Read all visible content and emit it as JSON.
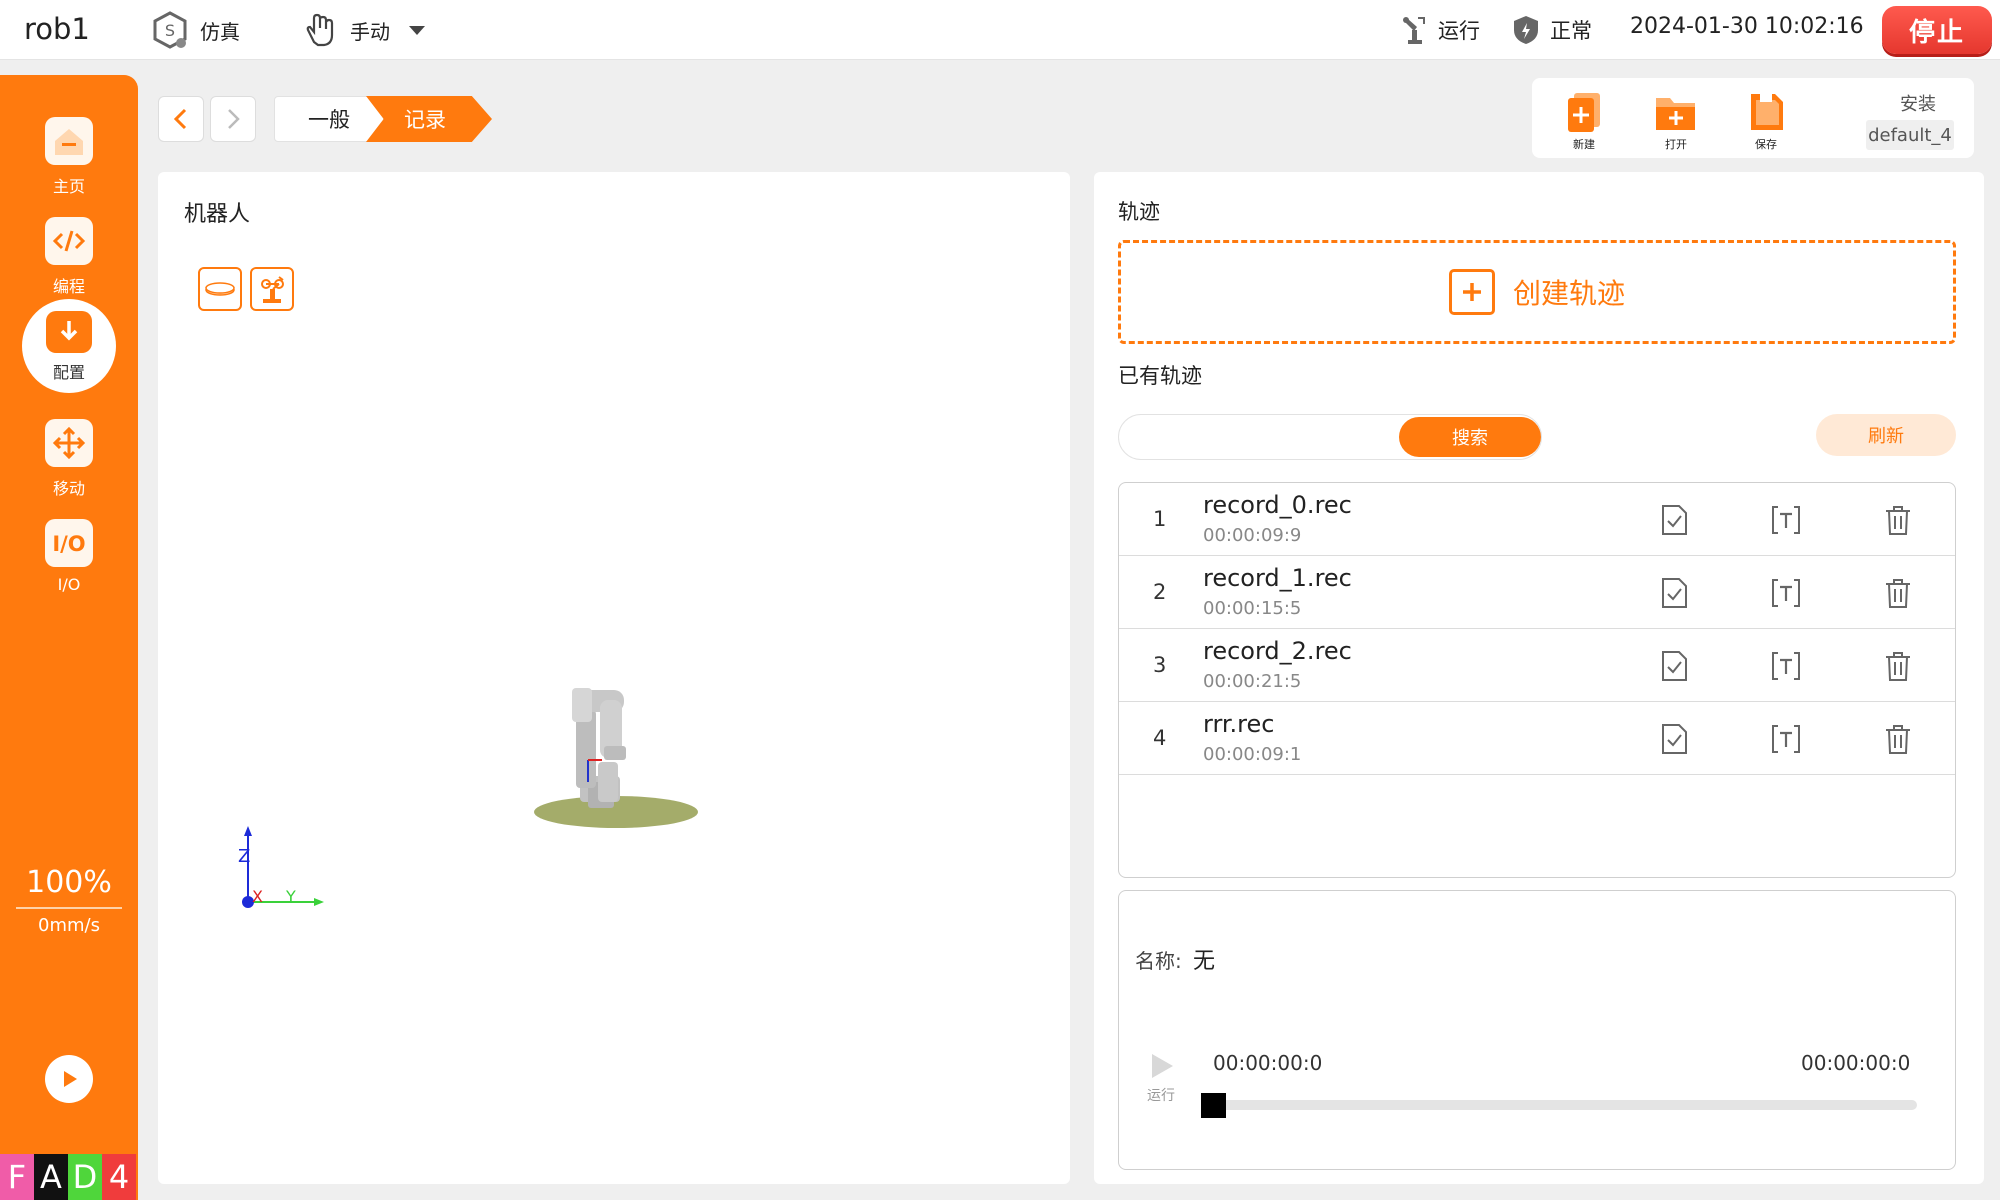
{
  "topbar": {
    "robot_name": "rob1",
    "sim_label": "仿真",
    "manual_label": "手动",
    "run_status": "运行",
    "health_status": "正常",
    "datetime": "2024-01-30 10:02:16",
    "stop_label": "停止"
  },
  "sidebar": {
    "items": [
      {
        "label": "主页",
        "icon": "home-icon"
      },
      {
        "label": "编程",
        "icon": "code-icon"
      },
      {
        "label": "配置",
        "icon": "config-download-icon"
      },
      {
        "label": "移动",
        "icon": "move-arrows-icon"
      },
      {
        "label": "I/O",
        "icon": "io-icon"
      }
    ],
    "active_item": "配置",
    "speed_percent": "100%",
    "speed_value": "0mm/s",
    "status_letters": [
      {
        "letter": "F",
        "color": "#f05ca8"
      },
      {
        "letter": "A",
        "color": "#111111"
      },
      {
        "letter": "D",
        "color": "#4fd63b"
      },
      {
        "letter": "4",
        "color": "#f03c3c"
      }
    ]
  },
  "breadcrumb": {
    "general_label": "一般",
    "record_label": "记录"
  },
  "file_toolbar": {
    "new_label": "新建",
    "open_label": "打开",
    "save_label": "保存",
    "install_label": "安装",
    "install_value": "default_4"
  },
  "robot_panel": {
    "title": "机器人",
    "axis_z": "Z",
    "axis_x": "X",
    "axis_y": "Y"
  },
  "track_panel": {
    "title": "轨迹",
    "create_label": "创建轨迹",
    "existing_title": "已有轨迹",
    "search_placeholder": "",
    "search_label": "搜索",
    "refresh_label": "刷新",
    "records": [
      {
        "index": "1",
        "name": "record_0.rec",
        "duration": "00:00:09:9"
      },
      {
        "index": "2",
        "name": "record_1.rec",
        "duration": "00:00:15:5"
      },
      {
        "index": "3",
        "name": "record_2.rec",
        "duration": "00:00:21:5"
      },
      {
        "index": "4",
        "name": "rrr.rec",
        "duration": "00:00:09:1"
      }
    ]
  },
  "player": {
    "name_label": "名称:",
    "name_value": "无",
    "run_label": "运行",
    "time_start": "00:00:00:0",
    "time_end": "00:00:00:0",
    "progress": 0
  },
  "colors": {
    "accent": "#ff7a0e",
    "stop": "#e5372e",
    "background": "#efefef"
  }
}
